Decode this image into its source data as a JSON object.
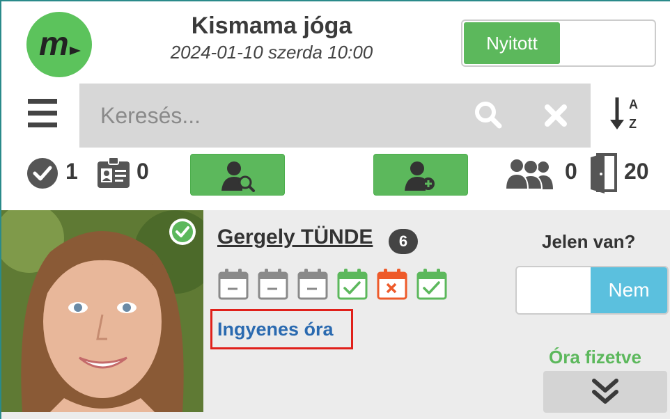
{
  "header": {
    "logo_letter": "m",
    "title": "Kismama jóga",
    "subtitle": "2024-01-10 szerda 10:00",
    "status_toggle_label": "Nyitott"
  },
  "search": {
    "placeholder": "Keresés...",
    "value": ""
  },
  "stats": {
    "checked_count": "1",
    "pass_count": "0",
    "group_count": "0",
    "door_count": "20"
  },
  "attendee": {
    "name": "Gergely TÜNDE",
    "badge_count": "6",
    "history": [
      "empty",
      "empty",
      "empty",
      "attended",
      "missed",
      "attended"
    ],
    "ticket_label": "Ingyenes óra",
    "present_question": "Jelen van?",
    "present_toggle_label": "Nem",
    "payment_status": "Óra fizetve"
  },
  "colors": {
    "accent_green": "#5cb85c",
    "info_blue": "#5bc0de",
    "link_blue": "#2a6ab0",
    "highlight_red": "#e0201a",
    "missed_orange": "#ee5a2a"
  }
}
